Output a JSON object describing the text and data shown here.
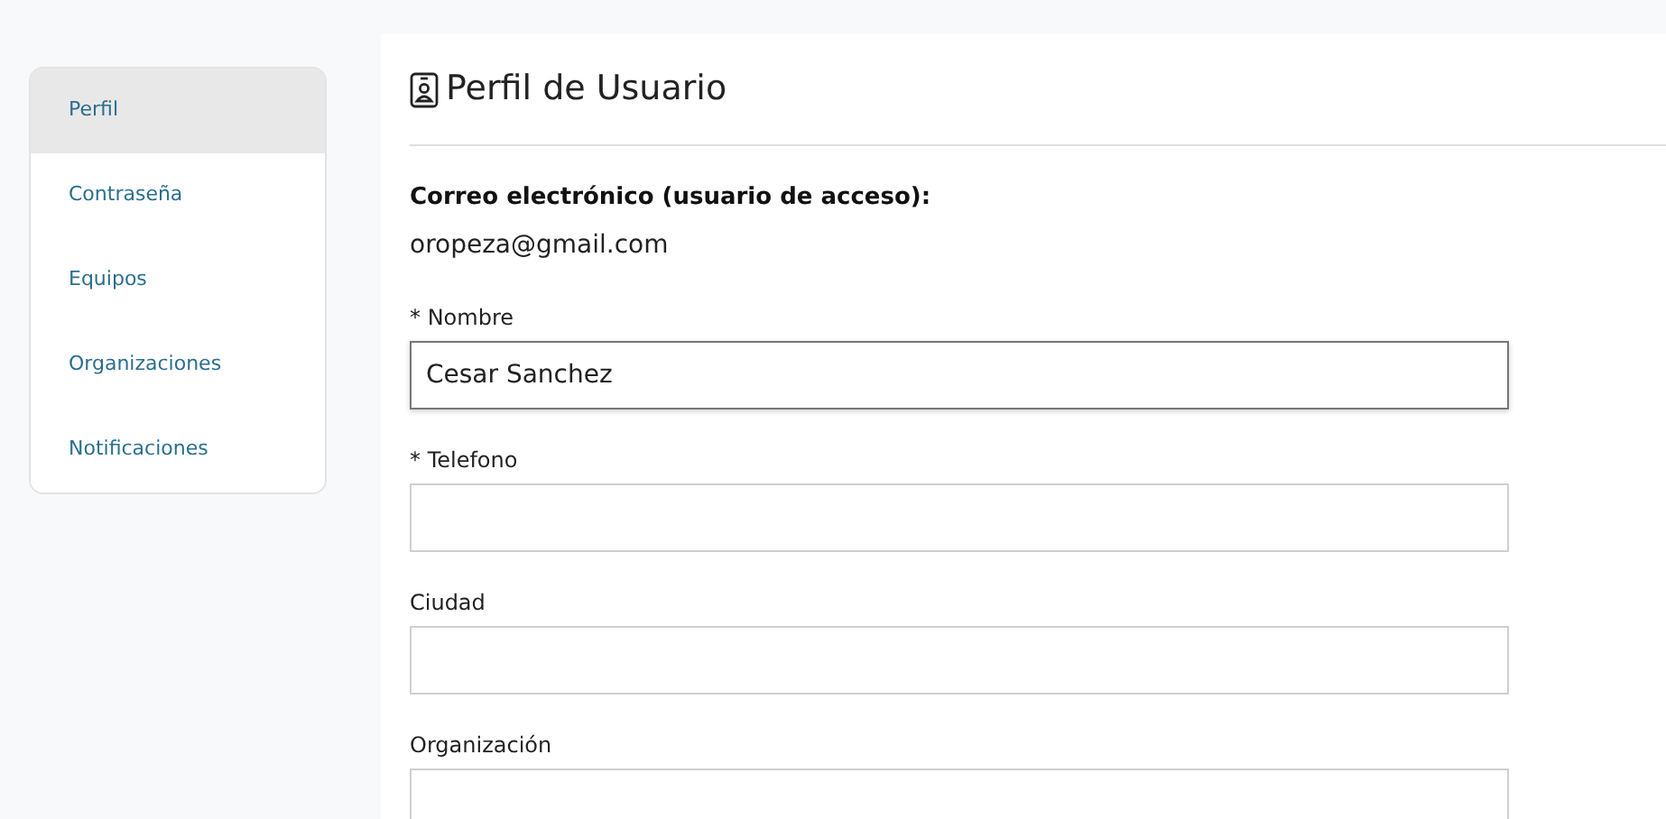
{
  "sidebar": {
    "items": [
      {
        "label": "Perfil",
        "selected": true
      },
      {
        "label": "Contraseña",
        "selected": false
      },
      {
        "label": "Equipos",
        "selected": false
      },
      {
        "label": "Organizaciones",
        "selected": false
      },
      {
        "label": "Notificaciones",
        "selected": false
      }
    ]
  },
  "header": {
    "title": "Perfil de Usuario"
  },
  "email": {
    "label": "Correo electrónico (usuario de acceso):",
    "value": "oropeza@gmail.com"
  },
  "fields": [
    {
      "label": "* Nombre",
      "value": "Cesar Sanchez",
      "focused": true
    },
    {
      "label": "* Telefono",
      "focused": false
    },
    {
      "label": "Ciudad",
      "focused": false
    },
    {
      "label": "Organización",
      "focused": false
    }
  ]
}
